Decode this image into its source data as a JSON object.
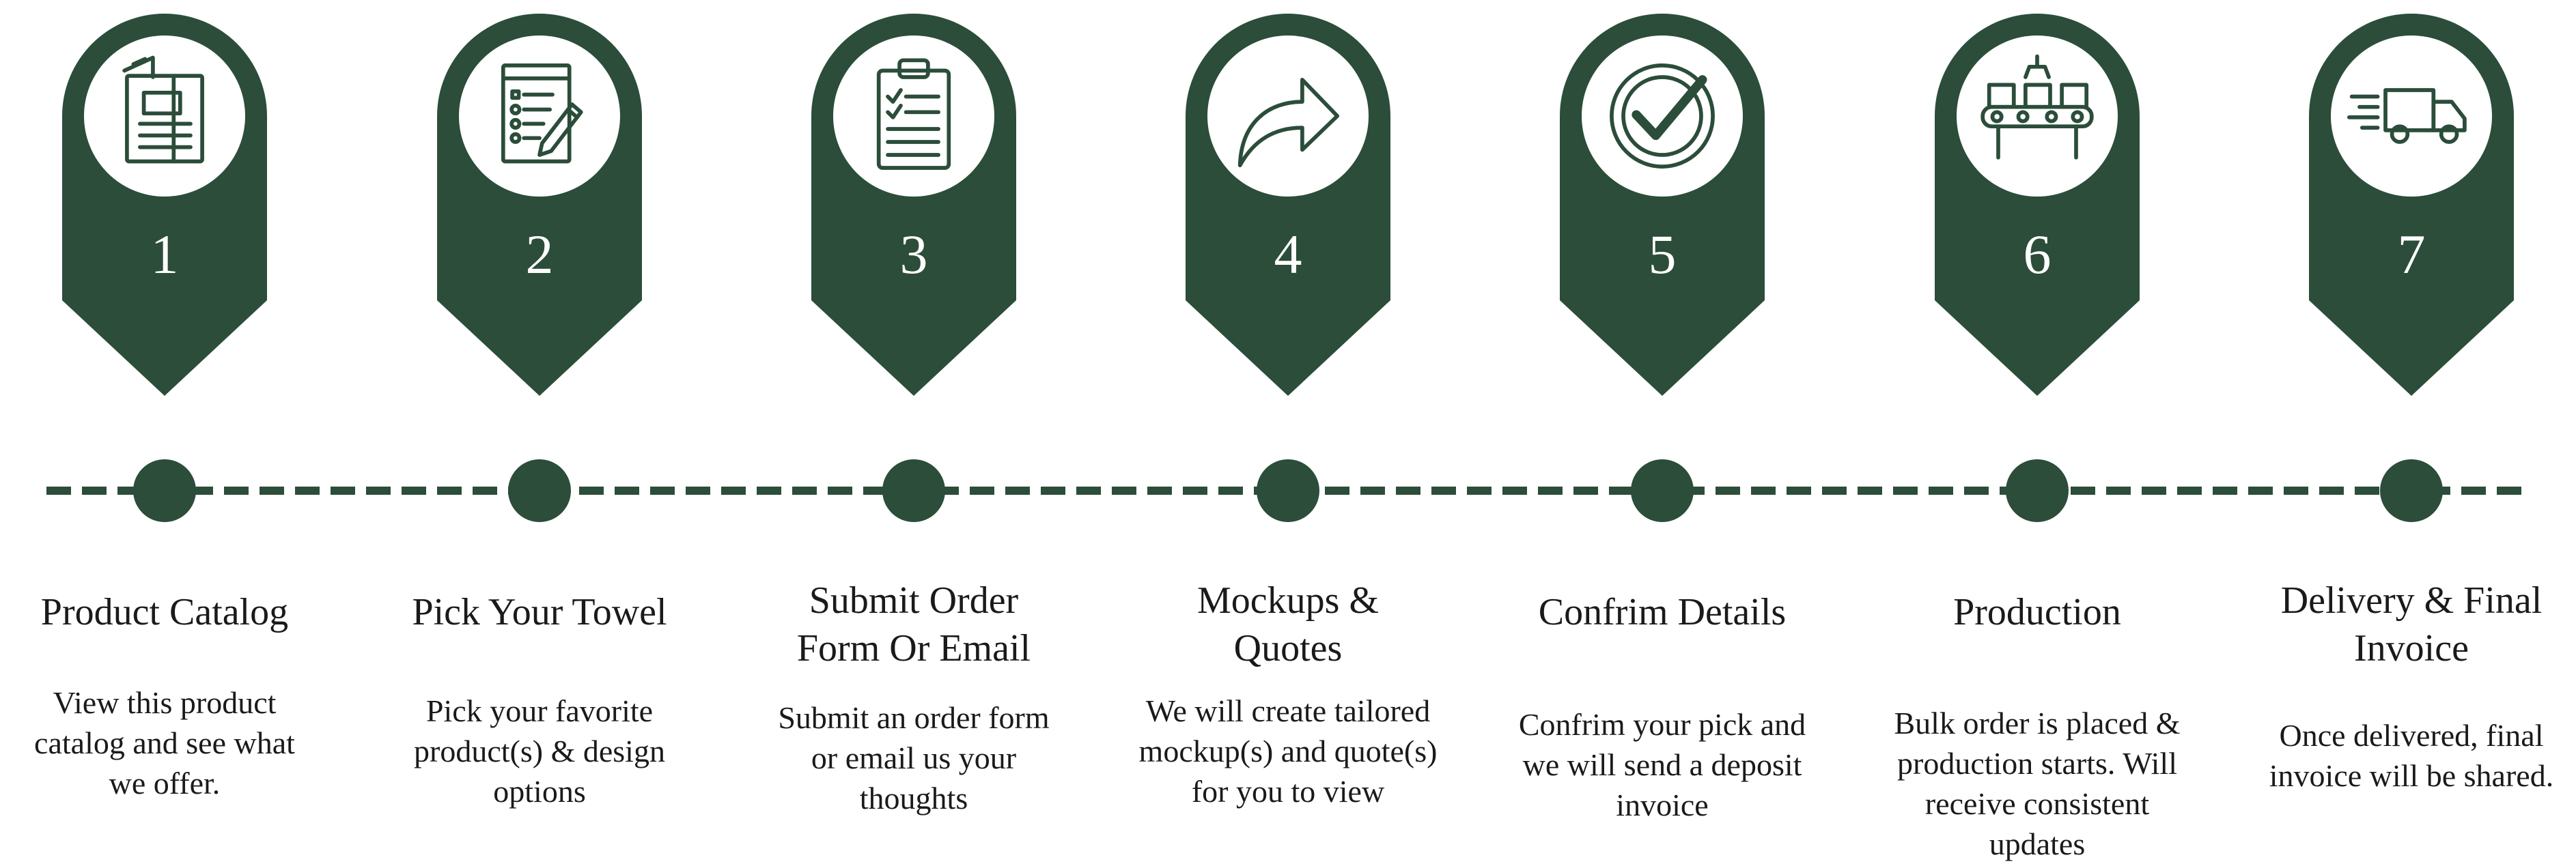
{
  "colors": {
    "accent": "#2b4d3a",
    "text": "#1a1a1a",
    "background": "#ffffff"
  },
  "steps": [
    {
      "number": "1",
      "icon": "catalog-icon",
      "title_lines": [
        "Product Catalog"
      ],
      "desc_lines": [
        "View this product",
        "catalog and see what",
        "we offer."
      ]
    },
    {
      "number": "2",
      "icon": "checklist-pencil-icon",
      "title_lines": [
        "Pick Your Towel"
      ],
      "desc_lines": [
        "Pick your favorite",
        "product(s) & design",
        "options"
      ]
    },
    {
      "number": "3",
      "icon": "clipboard-icon",
      "title_lines": [
        "Submit Order",
        "Form Or Email"
      ],
      "desc_lines": [
        "Submit an order form",
        "or email us your",
        "thoughts"
      ]
    },
    {
      "number": "4",
      "icon": "forward-arrow-icon",
      "title_lines": [
        "Mockups &",
        "Quotes"
      ],
      "desc_lines": [
        "We will create tailored",
        "mockup(s) and quote(s)",
        "for you to view"
      ]
    },
    {
      "number": "5",
      "icon": "checkmark-circle-icon",
      "title_lines": [
        "Confrim Details"
      ],
      "desc_lines": [
        "Confrim your pick and",
        "we will send a deposit",
        "invoice"
      ]
    },
    {
      "number": "6",
      "icon": "conveyor-belt-icon",
      "title_lines": [
        "Production"
      ],
      "desc_lines": [
        "Bulk order is placed &",
        "production starts. Will",
        "receive consistent",
        "updates"
      ]
    },
    {
      "number": "7",
      "icon": "delivery-truck-icon",
      "title_lines": [
        "Delivery & Final",
        "Invoice"
      ],
      "desc_lines": [
        "Once delivered, final",
        "invoice will be shared."
      ]
    }
  ]
}
